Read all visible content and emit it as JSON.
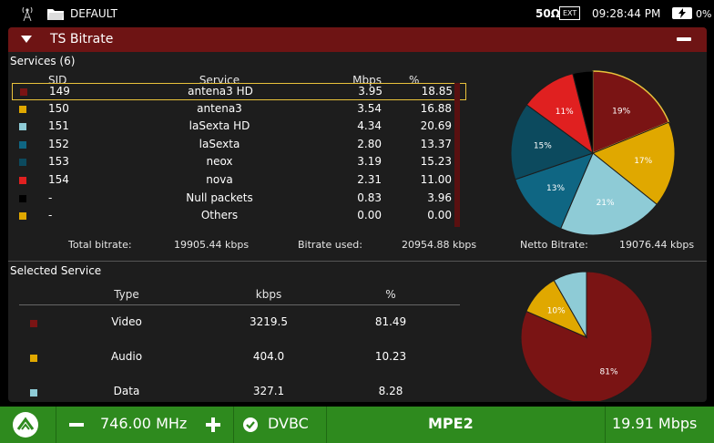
{
  "status_bar": {
    "project": "DEFAULT",
    "impedance": "50Ω",
    "ext_label": "EXT",
    "time": "09:28:44 PM",
    "battery": "0%"
  },
  "panel": {
    "title": "TS Bitrate"
  },
  "services": {
    "label": "Services (6)",
    "headers": [
      "SID",
      "Service",
      "Mbps",
      "%"
    ],
    "rows": [
      {
        "sid": "149",
        "name": "antena3 HD",
        "mbps": "3.95",
        "pct": "18.85",
        "color": "#7a1414",
        "selected": true
      },
      {
        "sid": "150",
        "name": "antena3",
        "mbps": "3.54",
        "pct": "16.88",
        "color": "#e0a800"
      },
      {
        "sid": "151",
        "name": "laSexta HD",
        "mbps": "4.34",
        "pct": "20.69",
        "color": "#8ecbd6"
      },
      {
        "sid": "152",
        "name": "laSexta",
        "mbps": "2.80",
        "pct": "13.37",
        "color": "#0f6683"
      },
      {
        "sid": "153",
        "name": "neox",
        "mbps": "3.19",
        "pct": "15.23",
        "color": "#0c4a5e"
      },
      {
        "sid": "154",
        "name": "nova",
        "mbps": "2.31",
        "pct": "11.00",
        "color": "#e02020"
      },
      {
        "sid": "-",
        "name": "Null packets",
        "mbps": "0.83",
        "pct": "3.96",
        "color": "#000000"
      },
      {
        "sid": "-",
        "name": "Others",
        "mbps": "0.00",
        "pct": "0.00",
        "color": "#e0a800"
      }
    ]
  },
  "totals": {
    "total_label": "Total bitrate:",
    "total_value": "19905.44 kbps",
    "used_label": "Bitrate used:",
    "used_value": "20954.88 kbps",
    "netto_label": "Netto Bitrate:",
    "netto_value": "19076.44 kbps"
  },
  "selected_service": {
    "label": "Selected Service",
    "headers": [
      "Type",
      "kbps",
      "%"
    ],
    "rows": [
      {
        "type": "Video",
        "kbps": "3219.5",
        "pct": "81.49",
        "color": "#7a1414"
      },
      {
        "type": "Audio",
        "kbps": "404.0",
        "pct": "10.23",
        "color": "#e0a800"
      },
      {
        "type": "Data",
        "kbps": "327.1",
        "pct": "8.28",
        "color": "#8ecbd6"
      }
    ]
  },
  "chart_data": [
    {
      "type": "pie",
      "slices": [
        {
          "label": "19%",
          "value": 18.85,
          "color": "#7a1414"
        },
        {
          "label": "17%",
          "value": 16.88,
          "color": "#e0a800"
        },
        {
          "label": "21%",
          "value": 20.69,
          "color": "#8ecbd6"
        },
        {
          "label": "13%",
          "value": 13.37,
          "color": "#0f6683"
        },
        {
          "label": "15%",
          "value": 15.23,
          "color": "#0c4a5e"
        },
        {
          "label": "11%",
          "value": 11.0,
          "color": "#e02020"
        },
        {
          "label": "",
          "value": 3.96,
          "color": "#000000"
        }
      ]
    },
    {
      "type": "pie",
      "slices": [
        {
          "label": "81%",
          "value": 81.49,
          "color": "#7a1414"
        },
        {
          "label": "10%",
          "value": 10.23,
          "color": "#e0a800"
        },
        {
          "label": "",
          "value": 8.28,
          "color": "#8ecbd6"
        }
      ]
    }
  ],
  "bottom_bar": {
    "frequency": "746.00 MHz",
    "standard": "DVBC",
    "mode": "MPE2",
    "rate": "19.91 Mbps"
  }
}
